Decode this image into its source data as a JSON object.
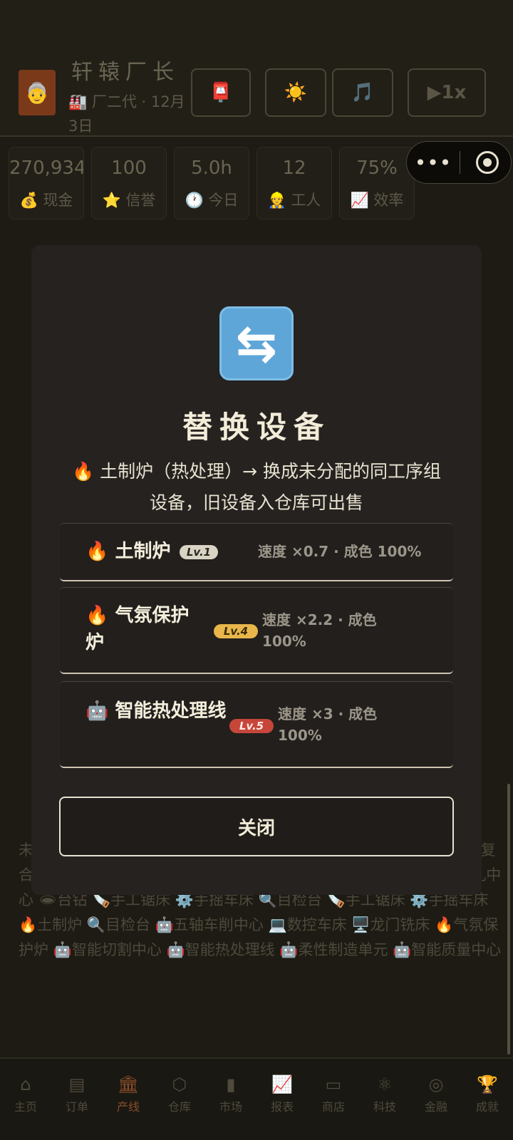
{
  "header": {
    "avatar_emoji": "👵",
    "title": "轩辕厂长",
    "subtitle": "🏭 厂二代 · 12月3日",
    "buttons": [
      {
        "label": "📮",
        "name": "mail-button"
      },
      {
        "label": "☀️",
        "name": "theme-button"
      },
      {
        "label": "🎵",
        "name": "music-button"
      },
      {
        "label": "▶1x",
        "name": "speed-button"
      }
    ]
  },
  "stats": [
    {
      "value": "270,934",
      "label": "💰 现金"
    },
    {
      "value": "100",
      "label": "⭐ 信誉"
    },
    {
      "value": "5.0h",
      "label": "🕐 今日"
    },
    {
      "value": "12",
      "label": "👷 工人"
    },
    {
      "value": "75%",
      "label": "📈 效率"
    }
  ],
  "background_text": "未 激 孔钻床 🔆激光切割机 🔍在线检测系统 🔍在线检测系统 🔄车铣复合中心 🤖五轴车削中心 🤖智能钻孔中心 🤖五轴车削中心 🤖智能钻孔中心 🕳台钻 🪚手工锯床 ⚙️手摇车床 🔍目检台 🪚手工锯床 ⚙️手摇车床 🔥土制炉 🔍目检台 🤖五轴车削中心 💻数控车床 🖥️龙门铣床 🔥气氛保护炉 🤖智能切割中心 🤖智能热处理线 🤖柔性制造单元 🤖智能质量中心",
  "tabs": [
    {
      "icon": "⌂",
      "label": "主页",
      "name": "tab-home"
    },
    {
      "icon": "▤",
      "label": "订单",
      "name": "tab-orders"
    },
    {
      "icon": "🏛",
      "label": "产线",
      "name": "tab-production"
    },
    {
      "icon": "⬡",
      "label": "仓库",
      "name": "tab-warehouse"
    },
    {
      "icon": "▮",
      "label": "市场",
      "name": "tab-market"
    },
    {
      "icon": "📈",
      "label": "报表",
      "name": "tab-reports"
    },
    {
      "icon": "▭",
      "label": "商店",
      "name": "tab-shop"
    },
    {
      "icon": "⚛",
      "label": "科技",
      "name": "tab-tech"
    },
    {
      "icon": "◎",
      "label": "金融",
      "name": "tab-finance"
    },
    {
      "icon": "🏆",
      "label": "成就",
      "name": "tab-achievements"
    }
  ],
  "active_tab": "产线",
  "modal": {
    "icon": "⇆",
    "title": "替换设备",
    "description": "🔥 土制炉（热处理）→ 换成未分配的同工序组设备，旧设备入仓库可出售",
    "options": [
      {
        "icon": "🔥",
        "name": "土制炉",
        "level": "Lv.1",
        "stats": "速度 ×0.7 · 成色 100%"
      },
      {
        "icon": "🔥",
        "name": "气氛保护炉",
        "level": "Lv.4",
        "stats": "速度 ×2.2 · 成色 100%"
      },
      {
        "icon": "🤖",
        "name": "智能热处理线",
        "level": "Lv.5",
        "stats": "速度 ×3 · 成色 100%"
      }
    ],
    "close_label": "关闭"
  },
  "colors": {
    "background": "#1d1b14",
    "modal": "#252220",
    "level1": "#d9d3c4",
    "level4": "#e8b64a",
    "level5": "#c6463a",
    "active_tab": "#8a4e2a"
  }
}
